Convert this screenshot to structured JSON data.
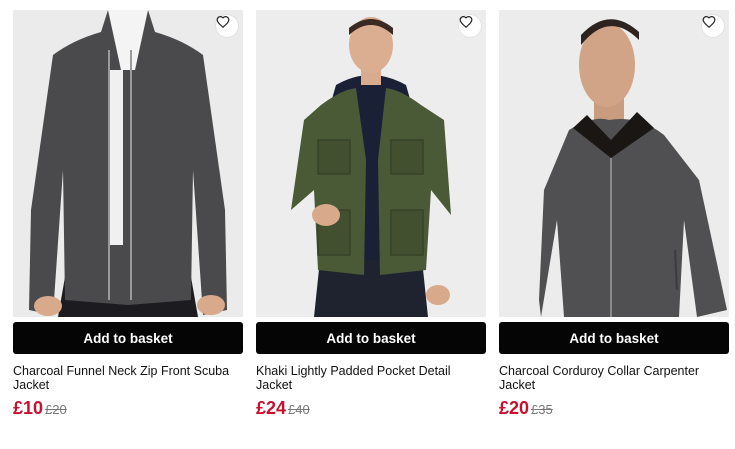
{
  "products": [
    {
      "name": "Charcoal Funnel Neck Zip Front Scuba Jacket",
      "button_label": "Add to basket",
      "price": "£10",
      "was_price": "£20",
      "wishlist_icon": "heart-outline-icon",
      "jacket_color": "#4a4a4c"
    },
    {
      "name": "Khaki Lightly Padded Pocket Detail Jacket",
      "button_label": "Add to basket",
      "price": "£24",
      "was_price": "£40",
      "wishlist_icon": "heart-outline-icon",
      "jacket_color": "#4b5a36"
    },
    {
      "name": "Charcoal Corduroy Collar Carpenter Jacket",
      "button_label": "Add to basket",
      "price": "£20",
      "was_price": "£35",
      "wishlist_icon": "heart-outline-icon",
      "jacket_color": "#505052"
    }
  ],
  "colors": {
    "sale_price": "#c8102e",
    "button_bg": "#050505",
    "image_bg": "#ececec"
  }
}
